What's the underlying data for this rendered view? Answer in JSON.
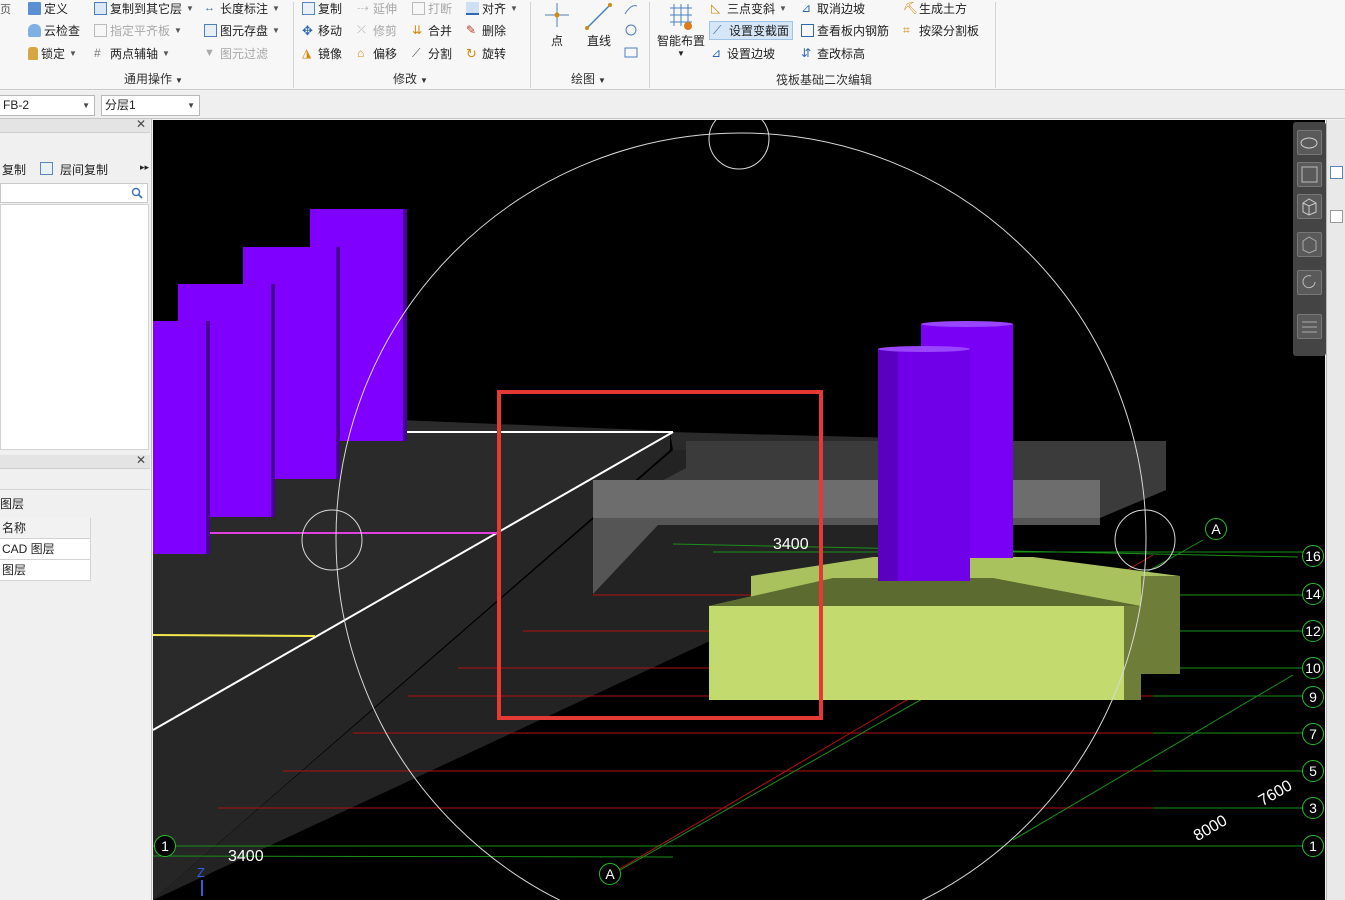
{
  "ribbon": {
    "common": {
      "items": [
        {
          "label": "定义",
          "icon": "define-icon"
        },
        {
          "label": "云检查",
          "icon": "cloud-check-icon"
        },
        {
          "label": "锁定",
          "icon": "lock-icon",
          "dropdown": true
        },
        {
          "label": "复制到其它层",
          "icon": "copy-layer-icon",
          "dropdown": true
        },
        {
          "label": "指定平齐板",
          "icon": "flush-slab-icon",
          "dropdown": true,
          "disabled": true
        },
        {
          "label": "两点辅轴",
          "icon": "aux-axis-icon",
          "dropdown": true
        },
        {
          "label": "长度标注",
          "icon": "dimension-icon",
          "dropdown": true
        },
        {
          "label": "图元存盘",
          "icon": "save-element-icon",
          "dropdown": true
        },
        {
          "label": "图元过滤",
          "icon": "filter-icon",
          "disabled": true
        }
      ],
      "group_title": "通用操作"
    },
    "modify": {
      "items": [
        {
          "label": "复制",
          "icon": "copy-icon"
        },
        {
          "label": "移动",
          "icon": "move-icon"
        },
        {
          "label": "镜像",
          "icon": "mirror-icon"
        },
        {
          "label": "延伸",
          "icon": "extend-icon",
          "disabled": true
        },
        {
          "label": "修剪",
          "icon": "trim-icon",
          "disabled": true
        },
        {
          "label": "偏移",
          "icon": "offset-icon"
        },
        {
          "label": "打断",
          "icon": "break-icon",
          "disabled": true
        },
        {
          "label": "合并",
          "icon": "merge-icon"
        },
        {
          "label": "分割",
          "icon": "split-icon"
        },
        {
          "label": "对齐",
          "icon": "align-icon",
          "dropdown": true
        },
        {
          "label": "删除",
          "icon": "delete-icon"
        },
        {
          "label": "旋转",
          "icon": "rotate-icon"
        }
      ],
      "group_title": "修改"
    },
    "draw": {
      "point_label": "点",
      "line_label": "直线",
      "group_title": "绘图"
    },
    "raft": {
      "smart_label": "智能布置",
      "items": [
        {
          "label": "三点变斜",
          "icon": "three-point-slope-icon",
          "dropdown": true
        },
        {
          "label": "设置变截面",
          "icon": "variable-section-icon",
          "highlighted": true
        },
        {
          "label": "设置边坡",
          "icon": "set-slope-icon"
        },
        {
          "label": "取消边坡",
          "icon": "cancel-slope-icon"
        },
        {
          "label": "查看板内钢筋",
          "icon": "view-rebar-icon"
        },
        {
          "label": "查改标高",
          "icon": "elevation-icon"
        },
        {
          "label": "生成土方",
          "icon": "earthwork-icon"
        },
        {
          "label": "按梁分割板",
          "icon": "split-by-beam-icon"
        }
      ],
      "group_title": "筏板基础二次编辑"
    }
  },
  "toolbar2": {
    "element_combo": "FB-2",
    "layer_combo": "分层1"
  },
  "left_panel": {
    "copy_label": "复制",
    "floor_copy_label": "层间复制",
    "layers_title": "图层",
    "table_header": "名称",
    "rows": [
      "CAD 图层",
      "图层"
    ]
  },
  "viewport": {
    "dim_top": "3400",
    "dim_bottom": "3400",
    "dim_right_1": "7600",
    "dim_right_2": "8000",
    "axis_a_top": "A",
    "axis_a_bottom": "A",
    "axis_1_left": "1",
    "axis_z": "Z",
    "right_axes": [
      "16",
      "14",
      "12",
      "10",
      "9",
      "7",
      "5",
      "3",
      "1"
    ]
  },
  "colors": {
    "column": "#8000ff",
    "footing": "#c2da6e",
    "slab": "#2a2a2a",
    "selection": "#e53935",
    "grid_green": "#1a8f1a",
    "grid_red": "#b01010"
  }
}
